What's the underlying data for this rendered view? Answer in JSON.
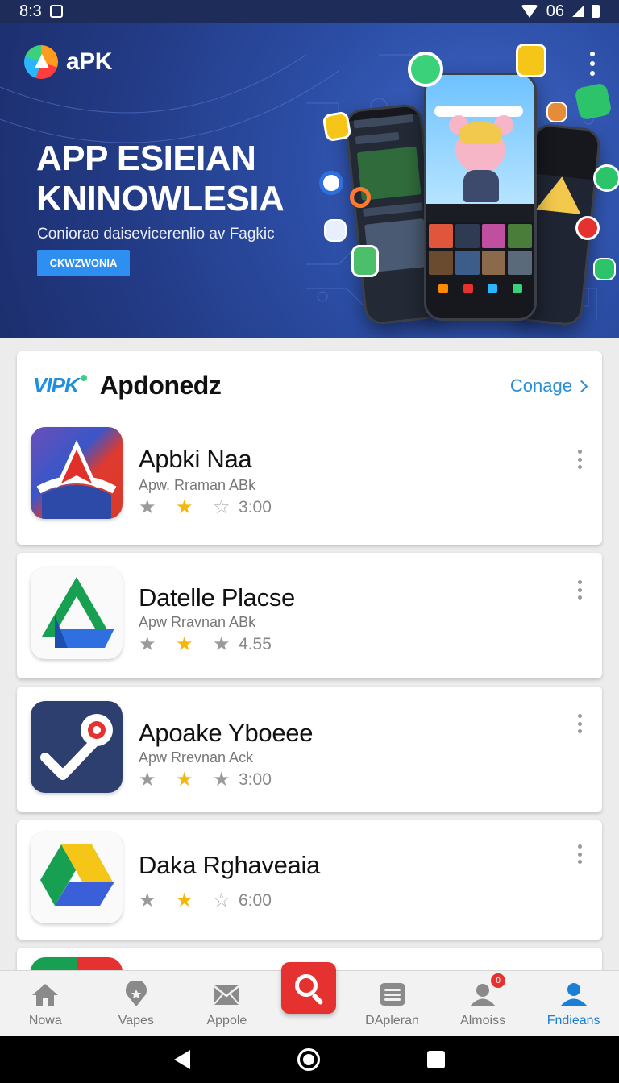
{
  "status_bar": {
    "time": "8:3",
    "battery": "06"
  },
  "hero": {
    "brand": "aPK",
    "title": "APP ESIEIAN KNINOWLESIA",
    "subtitle": "Coniorao daisevicerenlio av Fagkic",
    "button_label": "CKWZWONIA"
  },
  "list": {
    "brand": "VIPK",
    "title": "Apdonedz",
    "see_all": "Conage"
  },
  "apps": [
    {
      "name": "Apbki Naa",
      "subtitle": "Apw. Rraman ABk",
      "rating": "3:00"
    },
    {
      "name": "Datelle Placse",
      "subtitle": "Apw Rravnan ABk",
      "rating": "4.55"
    },
    {
      "name": "Apoake Yboeee",
      "subtitle": "Apw Rrevnan Ack",
      "rating": "3:00"
    },
    {
      "name": "Daka Rghaveaia",
      "subtitle": "",
      "rating": "6:00"
    }
  ],
  "bottom_nav": {
    "items": [
      {
        "label": "Nowa",
        "icon": "home-icon"
      },
      {
        "label": "Vapes",
        "icon": "location-pin-icon"
      },
      {
        "label": "Appole",
        "icon": "mail-icon"
      },
      {
        "label": "DApleran",
        "icon": "list-icon"
      },
      {
        "label": "Almoiss",
        "icon": "person-icon"
      },
      {
        "label": "Fndieans",
        "icon": "account-icon"
      }
    ],
    "center_icon": "search-icon",
    "notification_badge": "0"
  },
  "colors": {
    "accent": "#2a8fd8",
    "hero_bg": "#2c4ea6",
    "search_button": "#e5312f",
    "star": "#f5b70a"
  }
}
